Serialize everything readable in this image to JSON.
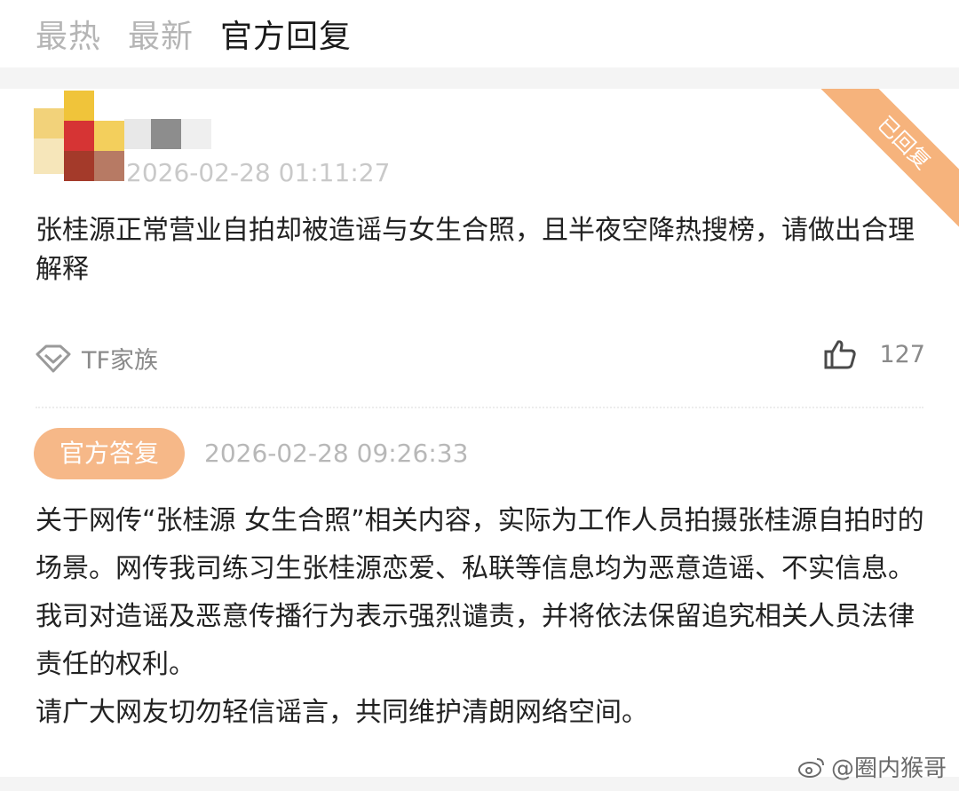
{
  "tabs": [
    {
      "label": "最热"
    },
    {
      "label": "最新"
    },
    {
      "label": "官方回复"
    }
  ],
  "post": {
    "ribbon": "已回复",
    "timestamp_visible": "2026-02-28 01:11:27",
    "question": "张桂源正常营业自拍却被造谣与女生合照，且半夜空降热搜榜，请做出合理解释",
    "tag": "TF家族",
    "likes": "127"
  },
  "reply": {
    "badge": "官方答复",
    "timestamp": "2026-02-28 09:26:33",
    "paragraphs": [
      "关于网传“张桂源 女生合照”相关内容，实际为工作人员拍摄张桂源自拍时的场景。网传我司练习生张桂源恋爱、私联等信息均为恶意造谣、不实信息。",
      "我司对造谣及恶意传播行为表示强烈谴责，并将依法保留追究相关人员法律责任的权利。",
      "请广大网友切勿轻信谣言，共同维护清朗网络空间。"
    ]
  },
  "watermark": "@圈内猴哥",
  "colors": {
    "accent_orange": "#f6b888",
    "ribbon": "#f6b37c",
    "muted_text": "#b5b5b5"
  },
  "icons": [
    "diamond-tag-icon",
    "thumbs-up-icon",
    "weibo-logo-icon"
  ]
}
